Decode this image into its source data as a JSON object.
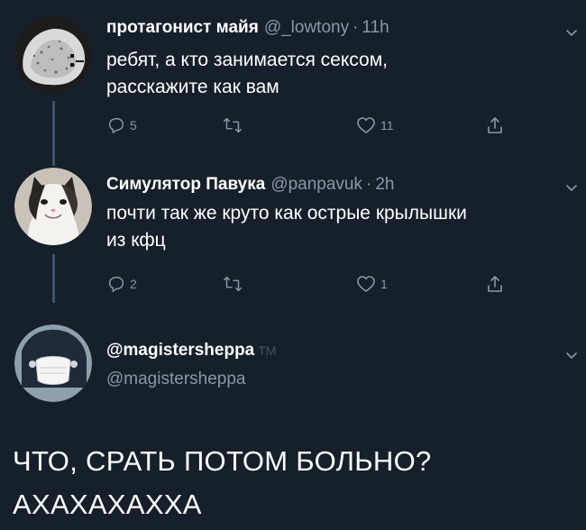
{
  "colors": {
    "background": "#15202b",
    "text": "#ffffff",
    "muted": "#8899a6",
    "thread_line": "#3d5466"
  },
  "tweets": [
    {
      "display_name": "протагонист майя",
      "handle": "@_lowtony",
      "time": "11h",
      "text_lines": [
        "ребят, а кто занимается сексом,",
        "расскажите как вам"
      ],
      "replies": "5",
      "retweets": "",
      "likes": "11",
      "avatar_icon": "rock-avatar-icon"
    },
    {
      "display_name": "Симулятор Павука",
      "handle": "@panpavuk",
      "time": "2h",
      "text_lines": [
        "почти так же круто как острые крылышки",
        "из кфц"
      ],
      "replies": "2",
      "retweets": "",
      "likes": "1",
      "avatar_icon": "cat-avatar-icon"
    }
  ],
  "user_card": {
    "display_name": "@magistersheppa",
    "tm": "TM",
    "handle": "@magistersheppa",
    "avatar_icon": "masked-avatar-icon"
  },
  "main_text_lines": [
    "ЧТО, СРАТЬ ПОТОМ БОЛЬНО?",
    "АХАХАХАХХА"
  ],
  "icons": {
    "reply": "reply-icon",
    "retweet": "retweet-icon",
    "like": "heart-icon",
    "share": "share-icon",
    "more": "chevron-down-icon"
  }
}
